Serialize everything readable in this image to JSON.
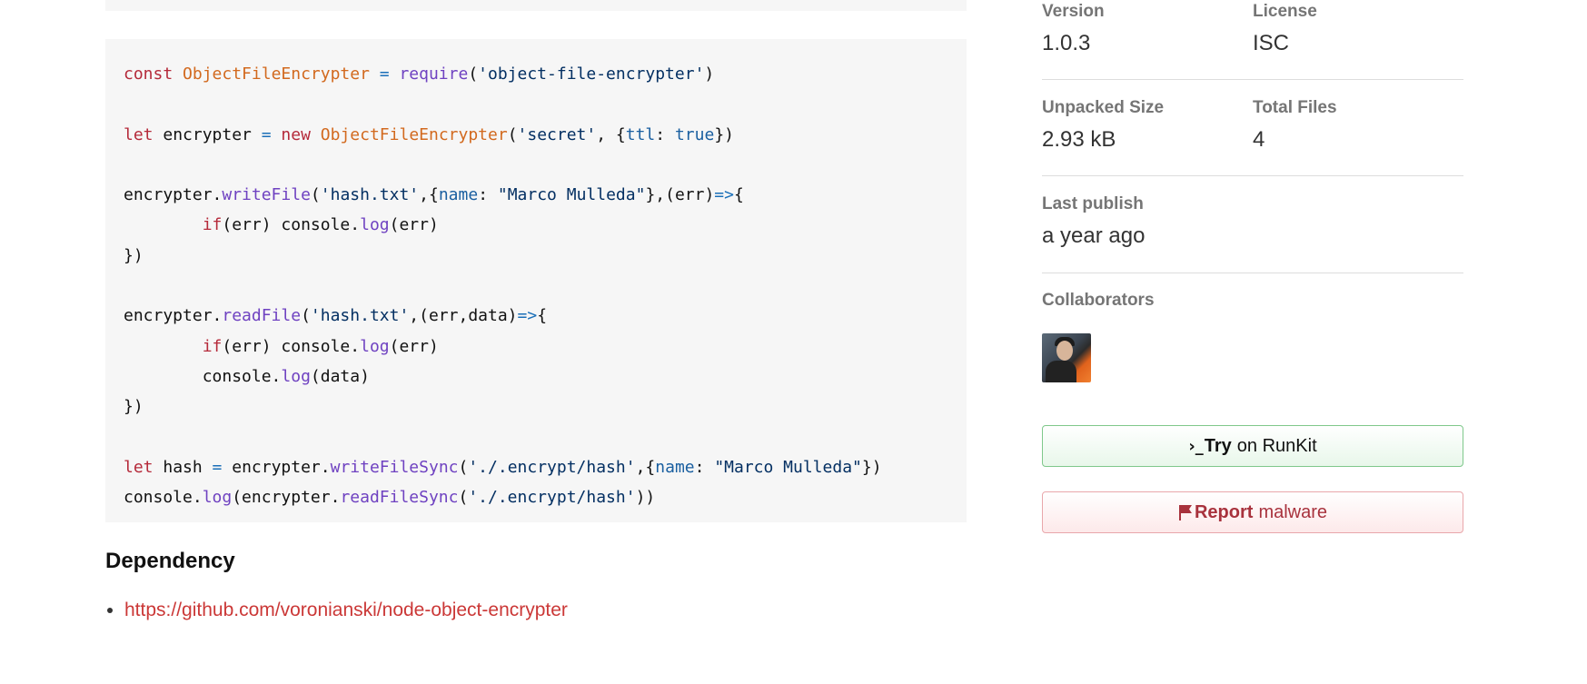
{
  "code": {
    "lines": [
      [
        [
          "kw",
          "const "
        ],
        [
          "cls",
          "ObjectFileEncrypter"
        ],
        [
          "op",
          " = "
        ],
        [
          "fn",
          "require"
        ],
        [
          "plain",
          "("
        ],
        [
          "str",
          "'object-file-encrypter'"
        ],
        [
          "plain",
          ")"
        ]
      ],
      [],
      [
        [
          "kw",
          "let "
        ],
        [
          "plain",
          "encrypter "
        ],
        [
          "op",
          "= "
        ],
        [
          "kw",
          "new "
        ],
        [
          "cls",
          "ObjectFileEncrypter"
        ],
        [
          "plain",
          "("
        ],
        [
          "str",
          "'secret'"
        ],
        [
          "plain",
          ", {"
        ],
        [
          "prop",
          "ttl"
        ],
        [
          "plain",
          ": "
        ],
        [
          "prop",
          "true"
        ],
        [
          "plain",
          "})"
        ]
      ],
      [],
      [
        [
          "plain",
          "encrypter."
        ],
        [
          "fn",
          "writeFile"
        ],
        [
          "plain",
          "("
        ],
        [
          "str",
          "'hash.txt'"
        ],
        [
          "plain",
          ",{"
        ],
        [
          "prop",
          "name"
        ],
        [
          "plain",
          ": "
        ],
        [
          "str",
          "\"Marco Mulleda\""
        ],
        [
          "plain",
          "},(err)"
        ],
        [
          "op",
          "=>"
        ],
        [
          "plain",
          "{"
        ]
      ],
      [
        [
          "plain",
          "        "
        ],
        [
          "kw",
          "if"
        ],
        [
          "plain",
          "(err) console."
        ],
        [
          "fn",
          "log"
        ],
        [
          "plain",
          "(err)"
        ]
      ],
      [
        [
          "plain",
          "})"
        ]
      ],
      [],
      [
        [
          "plain",
          "encrypter."
        ],
        [
          "fn",
          "readFile"
        ],
        [
          "plain",
          "("
        ],
        [
          "str",
          "'hash.txt'"
        ],
        [
          "plain",
          ",(err,data)"
        ],
        [
          "op",
          "=>"
        ],
        [
          "plain",
          "{"
        ]
      ],
      [
        [
          "plain",
          "        "
        ],
        [
          "kw",
          "if"
        ],
        [
          "plain",
          "(err) console."
        ],
        [
          "fn",
          "log"
        ],
        [
          "plain",
          "(err)"
        ]
      ],
      [
        [
          "plain",
          "        console."
        ],
        [
          "fn",
          "log"
        ],
        [
          "plain",
          "(data)"
        ]
      ],
      [
        [
          "plain",
          "})"
        ]
      ],
      [],
      [
        [
          "kw",
          "let "
        ],
        [
          "plain",
          "hash "
        ],
        [
          "op",
          "= "
        ],
        [
          "plain",
          "encrypter."
        ],
        [
          "fn",
          "writeFileSync"
        ],
        [
          "plain",
          "("
        ],
        [
          "str",
          "'./.encrypt/hash'"
        ],
        [
          "plain",
          ",{"
        ],
        [
          "prop",
          "name"
        ],
        [
          "plain",
          ": "
        ],
        [
          "str",
          "\"Marco Mulleda\""
        ],
        [
          "plain",
          "})"
        ]
      ],
      [
        [
          "plain",
          "console."
        ],
        [
          "fn",
          "log"
        ],
        [
          "plain",
          "(encrypter."
        ],
        [
          "fn",
          "readFileSync"
        ],
        [
          "plain",
          "("
        ],
        [
          "str",
          "'./.encrypt/hash'"
        ],
        [
          "plain",
          "))"
        ]
      ]
    ]
  },
  "dependency": {
    "heading": "Dependency",
    "links": [
      "https://github.com/voronianski/node-object-encrypter"
    ]
  },
  "sidebar": {
    "version_label": "Version",
    "version_value": "1.0.3",
    "license_label": "License",
    "license_value": "ISC",
    "unpacked_label": "Unpacked Size",
    "unpacked_value": "2.93 kB",
    "files_label": "Total Files",
    "files_value": "4",
    "publish_label": "Last publish",
    "publish_value": "a year ago",
    "collaborators_label": "Collaborators",
    "collaborators_icon": "avatar-photo",
    "runkit_bold": "Try",
    "runkit_light": "on RunKit",
    "runkit_icon": "terminal-prompt-icon",
    "report_bold": "Report",
    "report_light": "malware",
    "report_icon": "flag-icon"
  },
  "colors": {
    "link": "#cb3837",
    "code_bg": "#f6f6f6",
    "runkit_border": "#7fc88b",
    "report_border": "#e9a7ab"
  }
}
